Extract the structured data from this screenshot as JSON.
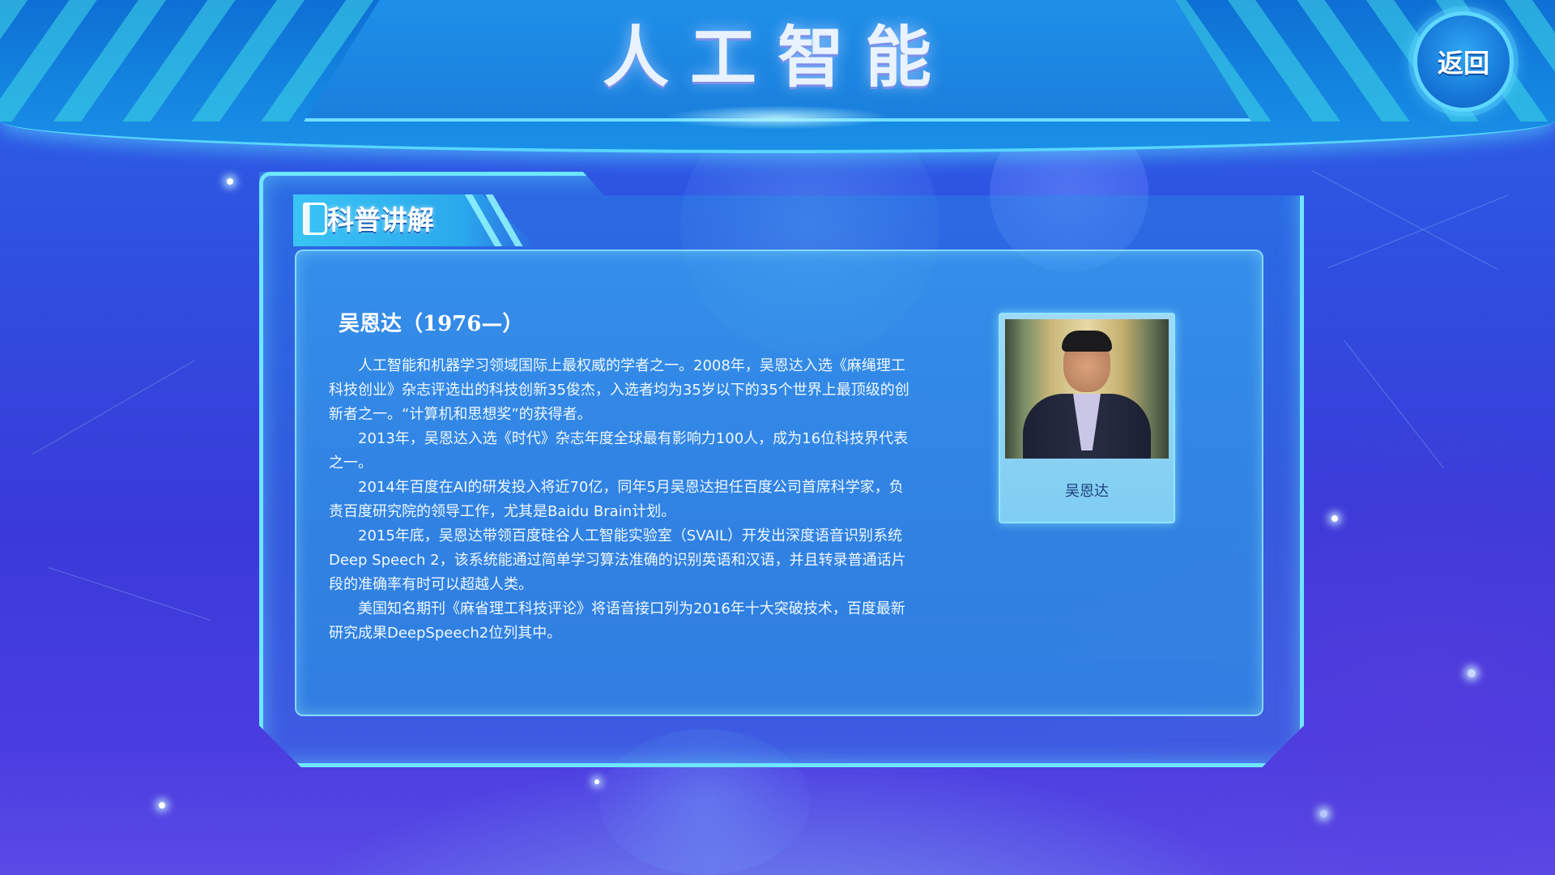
{
  "header": {
    "title": "人工智能",
    "back_label": "返回"
  },
  "panel": {
    "tab_title": "科普讲解",
    "person_title": "吴恩达（1976—）",
    "paragraphs": [
      "人工智能和机器学习领域国际上最权威的学者之一。2008年，吴恩达入选《麻绳理工科技创业》杂志评选出的科技创新35俊杰，入选者均为35岁以下的35个世界上最顶级的创新者之一。“计算机和思想奖”的获得者。",
      "2013年，吴恩达入选《时代》杂志年度全球最有影响力100人，成为16位科技界代表之一。",
      "2014年百度在AI的研发投入将近70亿，同年5月吴恩达担任百度公司首席科学家，负责百度研究院的领导工作，尤其是Baidu Brain计划。",
      "2015年底，吴恩达带领百度硅谷人工智能实验室（SVAIL）开发出深度语音识别系统Deep Speech 2，该系统能通过简单学习算法准确的识别英语和汉语，并且转录普通话片段的准确率有时可以超越人类。",
      "美国知名期刊《麻省理工科技评论》将语音接口列为2016年十大突破技术，百度最新研究成果DeepSpeech2位列其中。"
    ],
    "photo_caption": "吴恩达"
  },
  "icons": {
    "tab_icon": "book-icon"
  },
  "colors": {
    "accent": "#6fe6ff",
    "header": "#1385e0",
    "caption_text": "#1d3f7a"
  }
}
